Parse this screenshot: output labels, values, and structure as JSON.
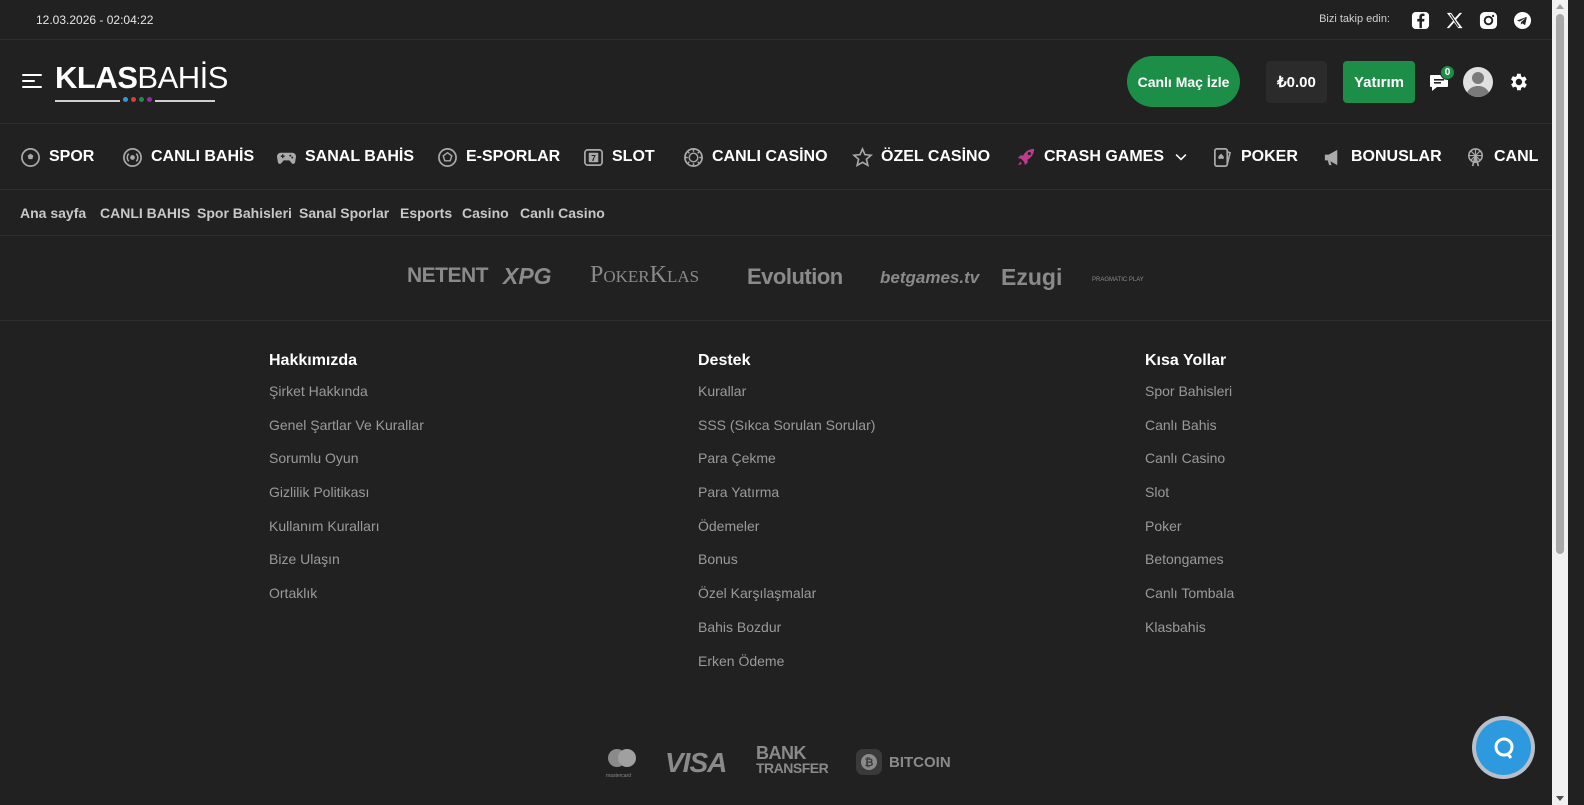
{
  "topbar": {
    "datetime": "12.03.2026 - 02:04:22",
    "follow_label": "Bizi takip edin:",
    "socials": [
      "facebook-icon",
      "x-icon",
      "instagram-icon",
      "telegram-icon"
    ]
  },
  "header": {
    "logo_bold": "KLAS",
    "logo_light": "BAHİS",
    "live_match_label": "Canlı Maç İzle",
    "balance": "₺0.00",
    "deposit_label": "Yatırım",
    "chat_badge": "0",
    "colors": {
      "accent": "#1d8e48",
      "logo_dots": [
        "#2d9ae0",
        "#e53935",
        "#1d8e48",
        "#9c27b0"
      ]
    }
  },
  "main_nav": [
    {
      "label": "SPOR",
      "icon": "soccer-ball-icon"
    },
    {
      "label": "CANLI BAHİS",
      "icon": "live-broadcast-icon"
    },
    {
      "label": "SANAL BAHİS",
      "icon": "gamepad-icon"
    },
    {
      "label": "E-SPORLAR",
      "icon": "esports-icon"
    },
    {
      "label": "SLOT",
      "icon": "slot-icon"
    },
    {
      "label": "CANLI CASİNO",
      "icon": "casino-chip-icon"
    },
    {
      "label": "ÖZEL CASİNO",
      "icon": "star-icon"
    },
    {
      "label": "CRASH GAMES",
      "icon": "rocket-icon"
    },
    {
      "label": "POKER",
      "icon": "poker-card-icon"
    },
    {
      "label": "BONUSLAR",
      "icon": "megaphone-icon"
    },
    {
      "label": "CANL",
      "icon": "ferris-wheel-icon"
    }
  ],
  "sub_nav": [
    "Ana sayfa",
    "CANLI BAHIS",
    "Spor Bahisleri",
    "Sanal Sporlar",
    "Esports",
    "Casino",
    "Canlı Casino"
  ],
  "providers": [
    "NETENT",
    "XPG",
    "PokerKlas",
    "Evolution",
    "betgames.tv",
    "Ezugi",
    "PRAGMATIC PLAY"
  ],
  "footer": {
    "about": {
      "title": "Hakkımızda",
      "links": [
        "Şirket Hakkında",
        "Genel Şartlar Ve Kurallar",
        "Sorumlu Oyun",
        "Gizlilik Politikası",
        "Kullanım Kuralları",
        "Bize Ulaşın",
        "Ortaklık"
      ]
    },
    "support": {
      "title": "Destek",
      "links": [
        "Kurallar",
        "SSS (Sıkca Sorulan Sorular)",
        "Para Çekme",
        "Para Yatırma",
        "Ödemeler",
        "Bonus",
        "Özel Karşılaşmalar",
        "Bahis Bozdur",
        "Erken Ödeme"
      ]
    },
    "shortcuts": {
      "title": "Kısa Yollar",
      "links": [
        "Spor Bahisleri",
        "Canlı Bahis",
        "Canlı Casino",
        "Slot",
        "Poker",
        "Betongames",
        "Canlı Tombala",
        "Klasbahis"
      ]
    }
  },
  "payments": {
    "mastercard": "mastercard",
    "visa": "VISA",
    "bank_line1": "BANK",
    "bank_line2": "TRANSFER",
    "bitcoin": "BITCOIN"
  }
}
